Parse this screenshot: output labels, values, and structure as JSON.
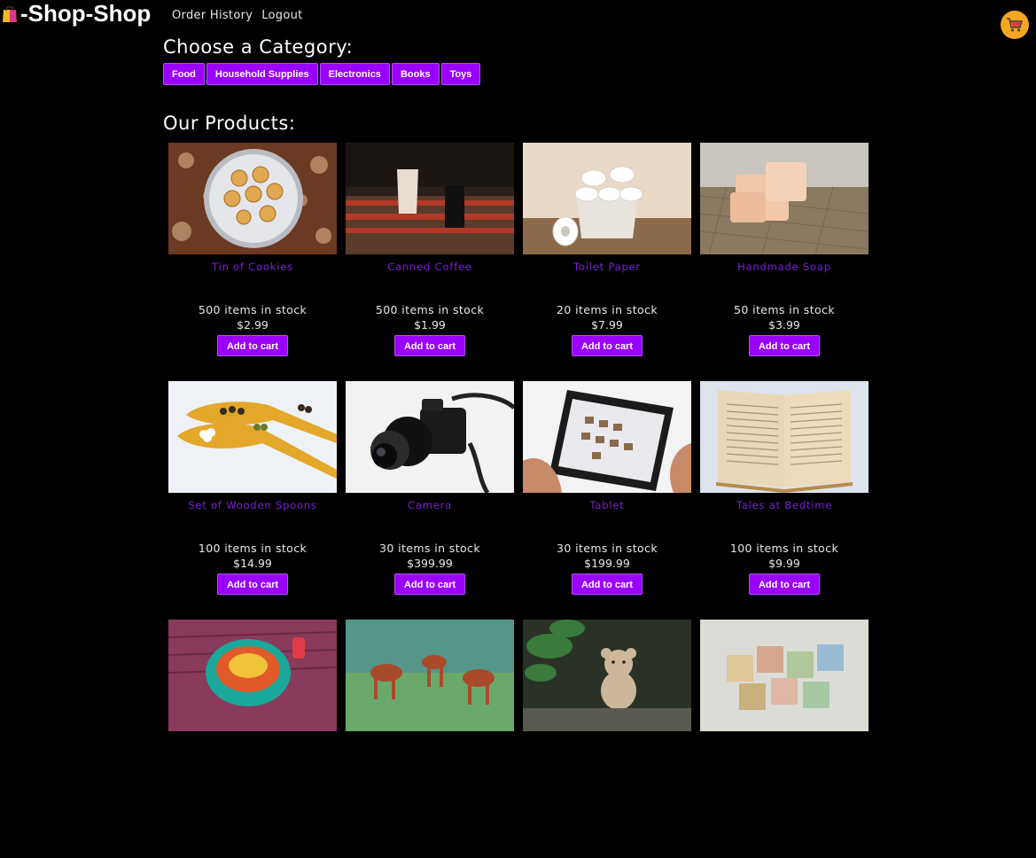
{
  "brand": {
    "title": "-Shop-Shop",
    "icon": "shopping-bag-icon"
  },
  "nav": {
    "order_history": "Order History",
    "logout": "Logout"
  },
  "cart": {
    "icon": "shopping-cart-icon"
  },
  "categories": {
    "heading": "Choose a Category:",
    "items": [
      "Food",
      "Household Supplies",
      "Electronics",
      "Books",
      "Toys"
    ]
  },
  "products": {
    "heading": "Our Products:",
    "add_label": "Add to cart",
    "items": [
      {
        "name": "Tin of Cookies",
        "stock": "500 items in stock",
        "price": "$2.99",
        "image": "cookies-photo"
      },
      {
        "name": "Canned Coffee",
        "stock": "500 items in stock",
        "price": "$1.99",
        "image": "coffee-photo"
      },
      {
        "name": "Toilet Paper",
        "stock": "20 items in stock",
        "price": "$7.99",
        "image": "toilet-paper-photo"
      },
      {
        "name": "Handmade Soap",
        "stock": "50 items in stock",
        "price": "$3.99",
        "image": "soap-photo"
      },
      {
        "name": "Set of Wooden Spoons",
        "stock": "100 items in stock",
        "price": "$14.99",
        "image": "spoons-photo"
      },
      {
        "name": "Camera",
        "stock": "30 items in stock",
        "price": "$399.99",
        "image": "camera-photo"
      },
      {
        "name": "Tablet",
        "stock": "30 items in stock",
        "price": "$199.99",
        "image": "tablet-photo"
      },
      {
        "name": "Tales at Bedtime",
        "stock": "100 items in stock",
        "price": "$9.99",
        "image": "book-photo"
      },
      {
        "name": "",
        "stock": "",
        "price": "",
        "image": "spinning-top-photo"
      },
      {
        "name": "",
        "stock": "",
        "price": "",
        "image": "toy-horses-photo"
      },
      {
        "name": "",
        "stock": "",
        "price": "",
        "image": "teddy-bear-photo"
      },
      {
        "name": "",
        "stock": "",
        "price": "",
        "image": "alphabet-blocks-photo"
      }
    ]
  },
  "colors": {
    "accent": "#9b00ff",
    "product_name": "#7a1fd6",
    "cart": "#f5a623",
    "background": "#000000"
  }
}
